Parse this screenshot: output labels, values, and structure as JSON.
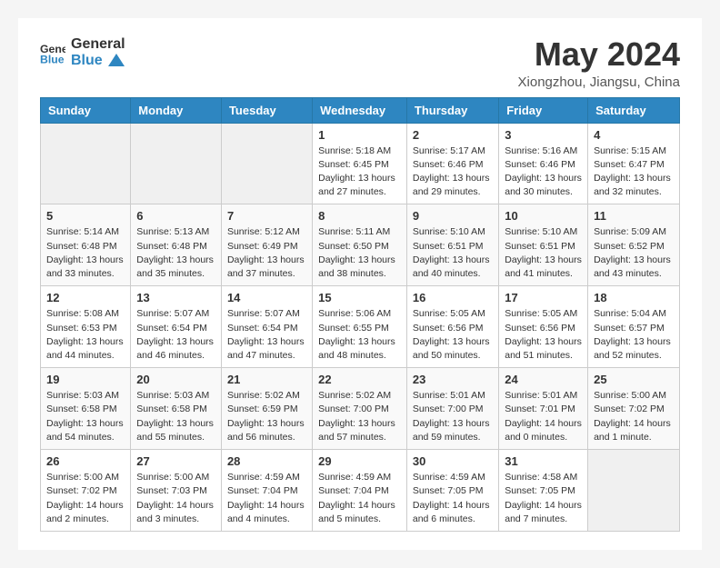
{
  "brand": {
    "name_part1": "General",
    "name_part2": "Blue"
  },
  "title": {
    "month_year": "May 2024",
    "location": "Xiongzhou, Jiangsu, China"
  },
  "days_of_week": [
    "Sunday",
    "Monday",
    "Tuesday",
    "Wednesday",
    "Thursday",
    "Friday",
    "Saturday"
  ],
  "weeks": [
    [
      {
        "day": "",
        "info": ""
      },
      {
        "day": "",
        "info": ""
      },
      {
        "day": "",
        "info": ""
      },
      {
        "day": "1",
        "info": "Sunrise: 5:18 AM\nSunset: 6:45 PM\nDaylight: 13 hours and 27 minutes."
      },
      {
        "day": "2",
        "info": "Sunrise: 5:17 AM\nSunset: 6:46 PM\nDaylight: 13 hours and 29 minutes."
      },
      {
        "day": "3",
        "info": "Sunrise: 5:16 AM\nSunset: 6:46 PM\nDaylight: 13 hours and 30 minutes."
      },
      {
        "day": "4",
        "info": "Sunrise: 5:15 AM\nSunset: 6:47 PM\nDaylight: 13 hours and 32 minutes."
      }
    ],
    [
      {
        "day": "5",
        "info": "Sunrise: 5:14 AM\nSunset: 6:48 PM\nDaylight: 13 hours and 33 minutes."
      },
      {
        "day": "6",
        "info": "Sunrise: 5:13 AM\nSunset: 6:48 PM\nDaylight: 13 hours and 35 minutes."
      },
      {
        "day": "7",
        "info": "Sunrise: 5:12 AM\nSunset: 6:49 PM\nDaylight: 13 hours and 37 minutes."
      },
      {
        "day": "8",
        "info": "Sunrise: 5:11 AM\nSunset: 6:50 PM\nDaylight: 13 hours and 38 minutes."
      },
      {
        "day": "9",
        "info": "Sunrise: 5:10 AM\nSunset: 6:51 PM\nDaylight: 13 hours and 40 minutes."
      },
      {
        "day": "10",
        "info": "Sunrise: 5:10 AM\nSunset: 6:51 PM\nDaylight: 13 hours and 41 minutes."
      },
      {
        "day": "11",
        "info": "Sunrise: 5:09 AM\nSunset: 6:52 PM\nDaylight: 13 hours and 43 minutes."
      }
    ],
    [
      {
        "day": "12",
        "info": "Sunrise: 5:08 AM\nSunset: 6:53 PM\nDaylight: 13 hours and 44 minutes."
      },
      {
        "day": "13",
        "info": "Sunrise: 5:07 AM\nSunset: 6:54 PM\nDaylight: 13 hours and 46 minutes."
      },
      {
        "day": "14",
        "info": "Sunrise: 5:07 AM\nSunset: 6:54 PM\nDaylight: 13 hours and 47 minutes."
      },
      {
        "day": "15",
        "info": "Sunrise: 5:06 AM\nSunset: 6:55 PM\nDaylight: 13 hours and 48 minutes."
      },
      {
        "day": "16",
        "info": "Sunrise: 5:05 AM\nSunset: 6:56 PM\nDaylight: 13 hours and 50 minutes."
      },
      {
        "day": "17",
        "info": "Sunrise: 5:05 AM\nSunset: 6:56 PM\nDaylight: 13 hours and 51 minutes."
      },
      {
        "day": "18",
        "info": "Sunrise: 5:04 AM\nSunset: 6:57 PM\nDaylight: 13 hours and 52 minutes."
      }
    ],
    [
      {
        "day": "19",
        "info": "Sunrise: 5:03 AM\nSunset: 6:58 PM\nDaylight: 13 hours and 54 minutes."
      },
      {
        "day": "20",
        "info": "Sunrise: 5:03 AM\nSunset: 6:58 PM\nDaylight: 13 hours and 55 minutes."
      },
      {
        "day": "21",
        "info": "Sunrise: 5:02 AM\nSunset: 6:59 PM\nDaylight: 13 hours and 56 minutes."
      },
      {
        "day": "22",
        "info": "Sunrise: 5:02 AM\nSunset: 7:00 PM\nDaylight: 13 hours and 57 minutes."
      },
      {
        "day": "23",
        "info": "Sunrise: 5:01 AM\nSunset: 7:00 PM\nDaylight: 13 hours and 59 minutes."
      },
      {
        "day": "24",
        "info": "Sunrise: 5:01 AM\nSunset: 7:01 PM\nDaylight: 14 hours and 0 minutes."
      },
      {
        "day": "25",
        "info": "Sunrise: 5:00 AM\nSunset: 7:02 PM\nDaylight: 14 hours and 1 minute."
      }
    ],
    [
      {
        "day": "26",
        "info": "Sunrise: 5:00 AM\nSunset: 7:02 PM\nDaylight: 14 hours and 2 minutes."
      },
      {
        "day": "27",
        "info": "Sunrise: 5:00 AM\nSunset: 7:03 PM\nDaylight: 14 hours and 3 minutes."
      },
      {
        "day": "28",
        "info": "Sunrise: 4:59 AM\nSunset: 7:04 PM\nDaylight: 14 hours and 4 minutes."
      },
      {
        "day": "29",
        "info": "Sunrise: 4:59 AM\nSunset: 7:04 PM\nDaylight: 14 hours and 5 minutes."
      },
      {
        "day": "30",
        "info": "Sunrise: 4:59 AM\nSunset: 7:05 PM\nDaylight: 14 hours and 6 minutes."
      },
      {
        "day": "31",
        "info": "Sunrise: 4:58 AM\nSunset: 7:05 PM\nDaylight: 14 hours and 7 minutes."
      },
      {
        "day": "",
        "info": ""
      }
    ]
  ]
}
